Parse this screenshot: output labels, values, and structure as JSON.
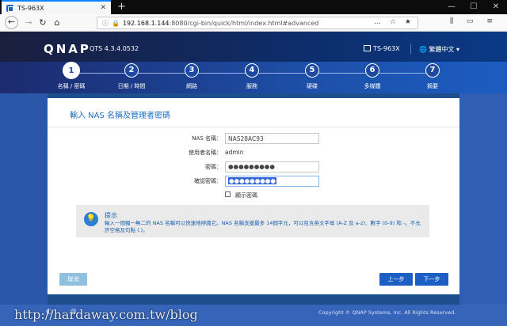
{
  "browser": {
    "tab_title": "TS-963X",
    "tab_close": "✕",
    "new_tab": "+",
    "url_host": "192.168.1.144",
    "url_rest": ":8080/cgi-bin/quick/html/index.html#advanced",
    "url_icons": "… ☆ ★",
    "tool_icons": "⫼ ▭ ≡",
    "win_minimize": "—",
    "win_maximize": "☐",
    "win_close": "✕"
  },
  "header": {
    "logo": "QNAP",
    "version": "QTS 4.3.4.0532",
    "model": "TS-963X",
    "language": "繁體中文 ▾"
  },
  "steps": [
    {
      "num": "1",
      "label": "名稱 / 密碼",
      "active": true
    },
    {
      "num": "2",
      "label": "日期 / 時間",
      "active": false
    },
    {
      "num": "3",
      "label": "網路",
      "active": false
    },
    {
      "num": "4",
      "label": "服務",
      "active": false
    },
    {
      "num": "5",
      "label": "硬碟",
      "active": false
    },
    {
      "num": "6",
      "label": "多媒體",
      "active": false
    },
    {
      "num": "7",
      "label": "摘要",
      "active": false
    }
  ],
  "form": {
    "title": "輸入 NAS 名稱及管理者密碼",
    "nas_name_label": "NAS 名稱：",
    "nas_name_value": "NAS28AC93",
    "username_label": "使用者名稱：",
    "username_value": "admin",
    "password_label": "密碼：",
    "password_value": "●●●●●●●●●",
    "confirm_label": "確認密碼：",
    "confirm_value": "●●●●●●●●●",
    "show_password_label": "顯示密碼"
  },
  "tip": {
    "icon": "💡",
    "title": "提示",
    "text": "輸入一個獨一無二的 NAS 名稱可以快速地辨識它。NAS 名稱支援最多 14個字元，可以包含英文字母 (A-Z 及 a-z)、數字 (0-9) 和 -。不允許空格及句點 (.)。"
  },
  "buttons": {
    "cancel": "取消",
    "prev": "上一步",
    "next": "下一步"
  },
  "footer": {
    "copyright": "Copyright © QNAP Systems, Inc. All Rights Reserved.",
    "watermark": "http://hardaway.com.tw/blog",
    "icons": "◐ ◍"
  },
  "colors": {
    "accent": "#1b5fc4",
    "header_bg": "#0d2d6b",
    "tip_text": "#1a5fb0"
  }
}
